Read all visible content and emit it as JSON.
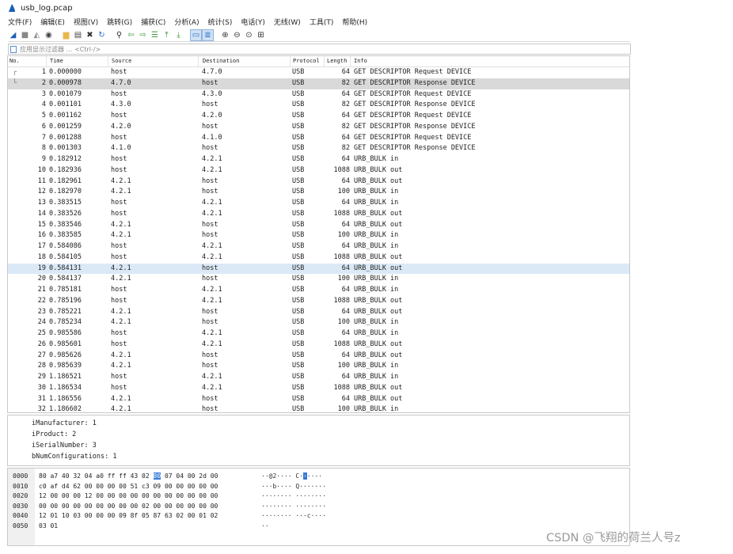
{
  "window": {
    "title": "usb_log.pcap"
  },
  "menu": [
    "文件(F)",
    "编辑(E)",
    "视图(V)",
    "跳转(G)",
    "捕获(C)",
    "分析(A)",
    "统计(S)",
    "电话(Y)",
    "无线(W)",
    "工具(T)",
    "帮助(H)"
  ],
  "toolbar_icons": [
    "shark-fin-start-icon",
    "stop-icon",
    "restart-icon",
    "options-gear-icon",
    "sep",
    "open-folder-icon",
    "save-icon",
    "close-file-icon",
    "reload-icon",
    "sep",
    "find-icon",
    "back-arrow-icon",
    "forward-arrow-icon",
    "goto-packet-icon",
    "first-packet-icon",
    "last-packet-icon",
    "sep",
    "autoscroll-icon",
    "colorize-icon",
    "sep",
    "zoom-in-icon",
    "zoom-out-icon",
    "zoom-normal-icon",
    "resize-columns-icon"
  ],
  "filter": {
    "placeholder": "应用显示过滤器 … <Ctrl-/>"
  },
  "columns": {
    "no": "No.",
    "time": "Time",
    "source": "Source",
    "destination": "Destination",
    "protocol": "Protocol",
    "length": "Length",
    "info": "Info"
  },
  "packets": [
    {
      "no": "1",
      "time": "0.000000",
      "source": "host",
      "destination": "4.7.0",
      "protocol": "USB",
      "length": "64",
      "info": "GET DESCRIPTOR Request DEVICE"
    },
    {
      "no": "2",
      "time": "0.000978",
      "source": "4.7.0",
      "destination": "host",
      "protocol": "USB",
      "length": "82",
      "info": "GET DESCRIPTOR Response DEVICE"
    },
    {
      "no": "3",
      "time": "0.001079",
      "source": "host",
      "destination": "4.3.0",
      "protocol": "USB",
      "length": "64",
      "info": "GET DESCRIPTOR Request DEVICE"
    },
    {
      "no": "4",
      "time": "0.001101",
      "source": "4.3.0",
      "destination": "host",
      "protocol": "USB",
      "length": "82",
      "info": "GET DESCRIPTOR Response DEVICE"
    },
    {
      "no": "5",
      "time": "0.001162",
      "source": "host",
      "destination": "4.2.0",
      "protocol": "USB",
      "length": "64",
      "info": "GET DESCRIPTOR Request DEVICE"
    },
    {
      "no": "6",
      "time": "0.001259",
      "source": "4.2.0",
      "destination": "host",
      "protocol": "USB",
      "length": "82",
      "info": "GET DESCRIPTOR Response DEVICE"
    },
    {
      "no": "7",
      "time": "0.001288",
      "source": "host",
      "destination": "4.1.0",
      "protocol": "USB",
      "length": "64",
      "info": "GET DESCRIPTOR Request DEVICE"
    },
    {
      "no": "8",
      "time": "0.001303",
      "source": "4.1.0",
      "destination": "host",
      "protocol": "USB",
      "length": "82",
      "info": "GET DESCRIPTOR Response DEVICE"
    },
    {
      "no": "9",
      "time": "0.182912",
      "source": "host",
      "destination": "4.2.1",
      "protocol": "USB",
      "length": "64",
      "info": "URB_BULK in"
    },
    {
      "no": "10",
      "time": "0.182936",
      "source": "host",
      "destination": "4.2.1",
      "protocol": "USB",
      "length": "1088",
      "info": "URB_BULK out"
    },
    {
      "no": "11",
      "time": "0.182961",
      "source": "4.2.1",
      "destination": "host",
      "protocol": "USB",
      "length": "64",
      "info": "URB_BULK out"
    },
    {
      "no": "12",
      "time": "0.182970",
      "source": "4.2.1",
      "destination": "host",
      "protocol": "USB",
      "length": "100",
      "info": "URB_BULK in"
    },
    {
      "no": "13",
      "time": "0.383515",
      "source": "host",
      "destination": "4.2.1",
      "protocol": "USB",
      "length": "64",
      "info": "URB_BULK in"
    },
    {
      "no": "14",
      "time": "0.383526",
      "source": "host",
      "destination": "4.2.1",
      "protocol": "USB",
      "length": "1088",
      "info": "URB_BULK out"
    },
    {
      "no": "15",
      "time": "0.383546",
      "source": "4.2.1",
      "destination": "host",
      "protocol": "USB",
      "length": "64",
      "info": "URB_BULK out"
    },
    {
      "no": "16",
      "time": "0.383585",
      "source": "4.2.1",
      "destination": "host",
      "protocol": "USB",
      "length": "100",
      "info": "URB_BULK in"
    },
    {
      "no": "17",
      "time": "0.584086",
      "source": "host",
      "destination": "4.2.1",
      "protocol": "USB",
      "length": "64",
      "info": "URB_BULK in"
    },
    {
      "no": "18",
      "time": "0.584105",
      "source": "host",
      "destination": "4.2.1",
      "protocol": "USB",
      "length": "1088",
      "info": "URB_BULK out"
    },
    {
      "no": "19",
      "time": "0.584131",
      "source": "4.2.1",
      "destination": "host",
      "protocol": "USB",
      "length": "64",
      "info": "URB_BULK out"
    },
    {
      "no": "20",
      "time": "0.584137",
      "source": "4.2.1",
      "destination": "host",
      "protocol": "USB",
      "length": "100",
      "info": "URB_BULK in"
    },
    {
      "no": "21",
      "time": "0.785181",
      "source": "host",
      "destination": "4.2.1",
      "protocol": "USB",
      "length": "64",
      "info": "URB_BULK in"
    },
    {
      "no": "22",
      "time": "0.785196",
      "source": "host",
      "destination": "4.2.1",
      "protocol": "USB",
      "length": "1088",
      "info": "URB_BULK out"
    },
    {
      "no": "23",
      "time": "0.785221",
      "source": "4.2.1",
      "destination": "host",
      "protocol": "USB",
      "length": "64",
      "info": "URB_BULK out"
    },
    {
      "no": "24",
      "time": "0.785234",
      "source": "4.2.1",
      "destination": "host",
      "protocol": "USB",
      "length": "100",
      "info": "URB_BULK in"
    },
    {
      "no": "25",
      "time": "0.985586",
      "source": "host",
      "destination": "4.2.1",
      "protocol": "USB",
      "length": "64",
      "info": "URB_BULK in"
    },
    {
      "no": "26",
      "time": "0.985601",
      "source": "host",
      "destination": "4.2.1",
      "protocol": "USB",
      "length": "1088",
      "info": "URB_BULK out"
    },
    {
      "no": "27",
      "time": "0.985626",
      "source": "4.2.1",
      "destination": "host",
      "protocol": "USB",
      "length": "64",
      "info": "URB_BULK out"
    },
    {
      "no": "28",
      "time": "0.985639",
      "source": "4.2.1",
      "destination": "host",
      "protocol": "USB",
      "length": "100",
      "info": "URB_BULK in"
    },
    {
      "no": "29",
      "time": "1.186521",
      "source": "host",
      "destination": "4.2.1",
      "protocol": "USB",
      "length": "64",
      "info": "URB_BULK in"
    },
    {
      "no": "30",
      "time": "1.186534",
      "source": "host",
      "destination": "4.2.1",
      "protocol": "USB",
      "length": "1088",
      "info": "URB_BULK out"
    },
    {
      "no": "31",
      "time": "1.186556",
      "source": "4.2.1",
      "destination": "host",
      "protocol": "USB",
      "length": "64",
      "info": "URB_BULK out"
    },
    {
      "no": "32",
      "time": "1.186602",
      "source": "4.2.1",
      "destination": "host",
      "protocol": "USB",
      "length": "100",
      "info": "URB_BULK in"
    }
  ],
  "selected_row_no": "2",
  "hover_row_no": "19",
  "details": [
    "iManufacturer: 1",
    "iProduct: 2",
    "iSerialNumber: 3",
    "bNumConfigurations: 1"
  ],
  "bytes": [
    {
      "offset": "0000",
      "pre": "80 a7 40 32 04 a0 ff ff  43 02 ",
      "hl": "80",
      "post": " 07 04 00 2d 00",
      "ascii_pre": "··@2····  C·",
      "ascii_hl": "·",
      "ascii_post": "··-·"
    },
    {
      "offset": "0010",
      "pre": "c0 af d4 62 00 00 00 00  51 c3 09 00 00 00 00 00",
      "hl": "",
      "post": "",
      "ascii_pre": "···b····  Q·······",
      "ascii_hl": "",
      "ascii_post": ""
    },
    {
      "offset": "0020",
      "pre": "12 00 00 00 12 00 00 00  00 00 00 00 00 00 00 00",
      "hl": "",
      "post": "",
      "ascii_pre": "········  ········",
      "ascii_hl": "",
      "ascii_post": ""
    },
    {
      "offset": "0030",
      "pre": "00 00 00 00 00 00 00 00  00 02 00 00 00 00 00 00",
      "hl": "",
      "post": "",
      "ascii_pre": "········  ········",
      "ascii_hl": "",
      "ascii_post": ""
    },
    {
      "offset": "0040",
      "pre": "12 01 10 03 00 00 00 09  8f 05 87 63 02 00 01 02",
      "hl": "",
      "post": "",
      "ascii_pre": "········  ···c····",
      "ascii_hl": "",
      "ascii_post": ""
    },
    {
      "offset": "0050",
      "pre": "03 01",
      "hl": "",
      "post": "",
      "ascii_pre": "··",
      "ascii_hl": "",
      "ascii_post": ""
    }
  ],
  "colors": {
    "selected_row": "#d9d9d9",
    "hover_row": "#dbe9f7",
    "byte_highlight": "#3a7bd5"
  },
  "watermark": "CSDN @飞翔的荷兰人号z"
}
